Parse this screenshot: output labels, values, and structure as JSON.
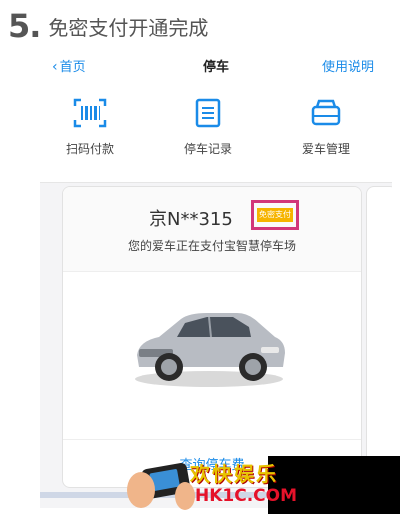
{
  "step": {
    "number": "5.",
    "text": "免密支付开通完成"
  },
  "nav": {
    "back_label": "首页",
    "title": "停车",
    "help_label": "使用说明"
  },
  "toolbar": {
    "items": [
      {
        "label": "扫码付款",
        "icon": "scan-barcode-icon"
      },
      {
        "label": "停车记录",
        "icon": "record-list-icon"
      },
      {
        "label": "爱车管理",
        "icon": "car-manage-icon"
      }
    ]
  },
  "card": {
    "plate": "京N**315",
    "badge": "免密支付",
    "subtitle": "您的爱车正在支付宝智慧停车场",
    "action": "查询停车费"
  },
  "watermark": {
    "line1": "欢快娱乐",
    "line2": "HK1C.COM"
  },
  "colors": {
    "accent": "#1a8be8",
    "badge": "#f6b400",
    "highlight": "#d2377a"
  }
}
